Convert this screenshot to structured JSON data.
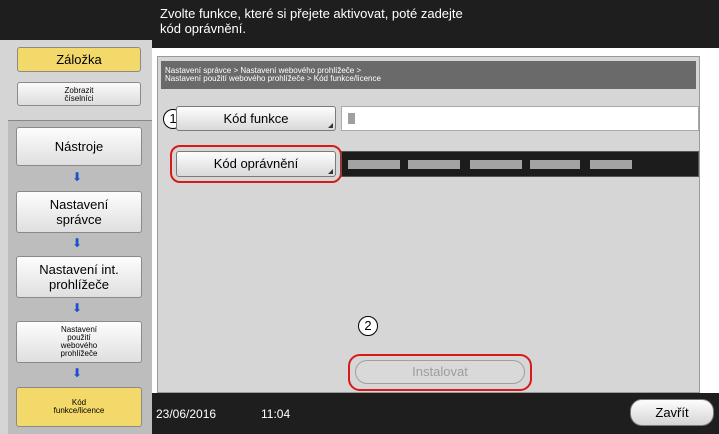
{
  "header": {
    "instruction_line1": "Zvolte funkce, které si přejete aktivovat, poté zadejte",
    "instruction_line2": "kód oprávnění."
  },
  "sidebar": {
    "tab_bookmark": "Záložka",
    "tab_show_numpad_line1": "Zobrazit",
    "tab_show_numpad_line2": "číselníci",
    "items": [
      {
        "label": "Nástroje"
      },
      {
        "label_line1": "Nastavení",
        "label_line2": "správce"
      },
      {
        "label_line1": "Nastavení int.",
        "label_line2": "prohlížeče"
      },
      {
        "label_line1": "Nastavení",
        "label_line2": "použití",
        "label_line3": "webového",
        "label_line4": "prohlížeče"
      },
      {
        "label_line1": "Kód",
        "label_line2": "funkce/licence"
      }
    ],
    "arrow_glyph": "⬇"
  },
  "breadcrumb": {
    "line1": "Nastavení správce > Nastavení webového prohlížeče >",
    "line2": "Nastavení použití webového prohlížeče > Kód funkce/licence"
  },
  "form": {
    "step1_number": "1",
    "function_code_button": "Kód funkce",
    "step2_number": "2",
    "auth_code_button": "Kód oprávnění",
    "install_button": "Instalovat"
  },
  "footer": {
    "date": "23/06/2016",
    "time": "11:04",
    "close_button": "Zavřít"
  },
  "colors": {
    "active_tab": "#f3d96a",
    "highlight": "#d81a1a",
    "arrow": "#1a4fd0",
    "header_bg": "#1e1e1e"
  }
}
